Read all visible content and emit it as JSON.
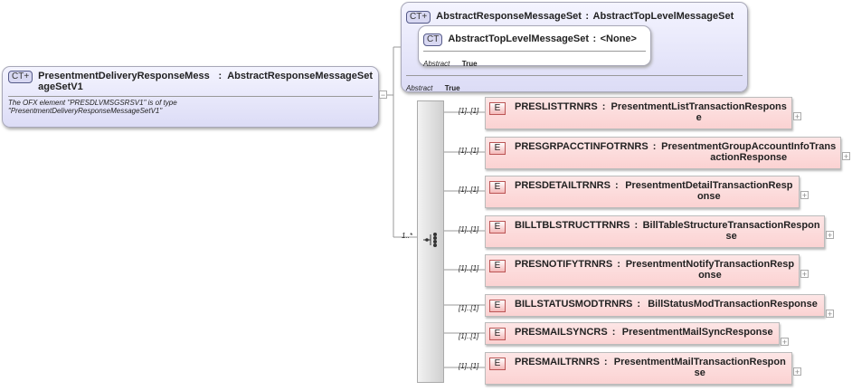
{
  "root": {
    "badge": "CT+",
    "name": "PresentmentDeliveryResponseMess ageSetV1",
    "sep": ":",
    "type": "AbstractResponseMessageSet",
    "doc": "The OFX element \"PRESDLVMSGSRSV1\" is of type \"PresentmentDeliveryResponseMessageSetV1\""
  },
  "base": {
    "badge": "CT+",
    "name": "AbstractResponseMessageSet",
    "sep": ":",
    "type": "AbstractTopLevelMessageSet",
    "prop_label": "Abstract",
    "prop_value": "True",
    "inner": {
      "badge": "CT",
      "name": "AbstractTopLevelMessageSet",
      "sep": ":",
      "type": "<None>",
      "prop_label": "Abstract",
      "prop_value": "True"
    }
  },
  "sequence": {
    "cardinality": "1..*",
    "icon": "sequence-compositor-icon"
  },
  "elements": [
    {
      "card": "[1]..[1]",
      "badge": "E",
      "name": "PRESLISTTRNRS",
      "type": "PresentmentListTransactionResponse"
    },
    {
      "card": "[1]..[1]",
      "badge": "E",
      "name": "PRESGRPACCTINFOTRNRS",
      "type": "PresentmentGroupAccountInfoTransactionResponse"
    },
    {
      "card": "[1]..[1]",
      "badge": "E",
      "name": "PRESDETAILTRNRS",
      "type": "PresentmentDetailTransactionResponse"
    },
    {
      "card": "[1]..[1]",
      "badge": "E",
      "name": "BILLTBLSTRUCTTRNRS",
      "type": "BillTableStructureTransactionResponse"
    },
    {
      "card": "[1]..[1]",
      "badge": "E",
      "name": "PRESNOTIFYTRNRS",
      "type": "PresentmentNotifyTransactionResponse"
    },
    {
      "card": "[1]..[1]",
      "badge": "E",
      "name": "BILLSTATUSMODTRNRS",
      "type": "BillStatusModTransactionResponse"
    },
    {
      "card": "[1]..[1]",
      "badge": "E",
      "name": "PRESMAILSYNCRS",
      "type": "PresentmentMailSyncResponse"
    },
    {
      "card": "[1]..[1]",
      "badge": "E",
      "name": "PRESMAILTRNRS",
      "type": "PresentmentMailTransactionResponse"
    }
  ]
}
